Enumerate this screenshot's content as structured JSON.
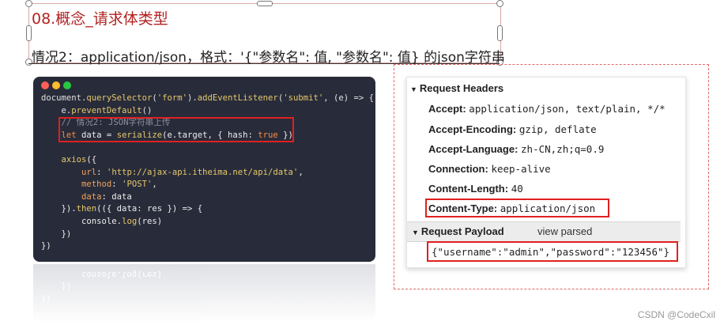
{
  "slide": {
    "title": "08.概念_请求体类型",
    "subtitle": "情况2：application/json，格式：'{\"参数名\": 值, \"参数名\": 值} 的json字符串"
  },
  "code_window": {
    "lines": [
      {
        "parts": [
          [
            "k",
            "document."
          ],
          [
            "fn",
            "querySelector"
          ],
          [
            "k",
            "("
          ],
          [
            "str",
            "'form'"
          ],
          [
            "k",
            ")."
          ],
          [
            "fn",
            "addEventListener"
          ],
          [
            "k",
            "("
          ],
          [
            "str",
            "'submit'"
          ],
          [
            "k",
            ", (e) => {"
          ]
        ]
      },
      {
        "parts": [
          [
            "k",
            "    e."
          ],
          [
            "fn",
            "preventDefault"
          ],
          [
            "k",
            "()"
          ]
        ]
      },
      {
        "parts": [
          [
            "cmt",
            "    // 情况2: JSON字符串上传"
          ]
        ]
      },
      {
        "parts": [
          [
            "kw",
            "    let "
          ],
          [
            "plain",
            "data = "
          ],
          [
            "fn",
            "serialize"
          ],
          [
            "plain",
            "(e.target, { hash: "
          ],
          [
            "kw",
            "true"
          ],
          [
            "plain",
            " })"
          ]
        ]
      },
      {
        "parts": [
          [
            "plain",
            " "
          ]
        ]
      },
      {
        "parts": [
          [
            "fn",
            "    axios"
          ],
          [
            "plain",
            "({"
          ]
        ]
      },
      {
        "parts": [
          [
            "prop",
            "        url"
          ],
          [
            "plain",
            ": "
          ],
          [
            "str",
            "'http://ajax-api.itheima.net/api/data'"
          ],
          [
            "plain",
            ","
          ]
        ]
      },
      {
        "parts": [
          [
            "prop",
            "        method"
          ],
          [
            "plain",
            ": "
          ],
          [
            "str",
            "'POST'"
          ],
          [
            "plain",
            ","
          ]
        ]
      },
      {
        "parts": [
          [
            "prop",
            "        data"
          ],
          [
            "plain",
            ": data"
          ]
        ]
      },
      {
        "parts": [
          [
            "plain",
            "    })."
          ],
          [
            "fn",
            "then"
          ],
          [
            "plain",
            "(({ data: res }) => {"
          ]
        ]
      },
      {
        "parts": [
          [
            "plain",
            "        console."
          ],
          [
            "fn",
            "log"
          ],
          [
            "plain",
            "(res)"
          ]
        ]
      },
      {
        "parts": [
          [
            "plain",
            "    })"
          ]
        ]
      },
      {
        "parts": [
          [
            "plain",
            "})"
          ]
        ]
      }
    ],
    "reflection_lines": [
      "})",
      "    })",
      "        console.log(res)"
    ],
    "dot_colors": [
      "#ff5f57",
      "#febc2e",
      "#28c840"
    ]
  },
  "devtools": {
    "request_headers_title": "Request Headers",
    "headers": [
      {
        "name": "Accept:",
        "value": "application/json, text/plain, */*"
      },
      {
        "name": "Accept-Encoding:",
        "value": "gzip, deflate"
      },
      {
        "name": "Accept-Language:",
        "value": "zh-CN,zh;q=0.9"
      },
      {
        "name": "Connection:",
        "value": "keep-alive"
      },
      {
        "name": "Content-Length:",
        "value": "40"
      },
      {
        "name": "Content-Type:",
        "value": "application/json"
      }
    ],
    "payload_title": "Request Payload",
    "view_parsed_label": "view parsed",
    "payload_json": "{\"username\":\"admin\",\"password\":\"123456\"}",
    "triangle_icon": "triangle-down-icon"
  },
  "watermark": "CSDN @CodeCxil",
  "colors": {
    "highlight_red": "#e02020",
    "code_bg": "#282c3a",
    "title_red": "#b22222"
  }
}
